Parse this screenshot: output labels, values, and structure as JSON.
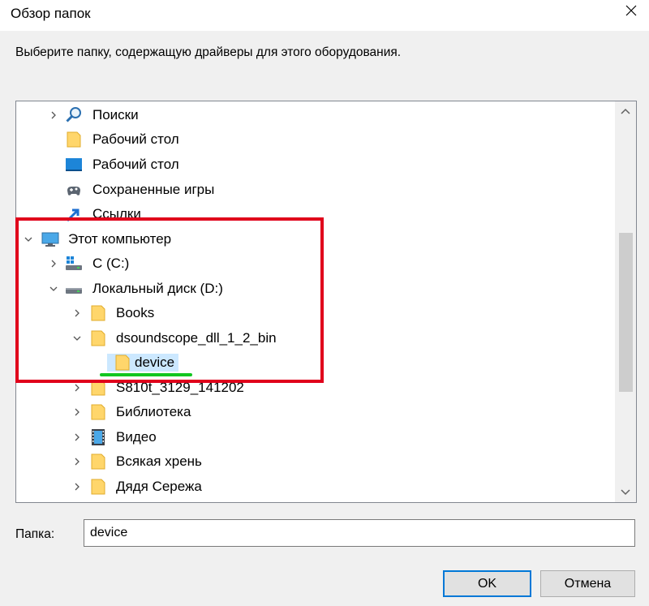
{
  "dialog": {
    "title": "Обзор папок",
    "instruction": "Выберите папку, содержащую драйверы для этого оборудования."
  },
  "tree": {
    "items": [
      {
        "label": "Поиски",
        "icon": "search-icon",
        "expander": "collapsed"
      },
      {
        "label": "Рабочий стол",
        "icon": "folder-icon",
        "expander": "none"
      },
      {
        "label": "Рабочий стол",
        "icon": "desktop-icon",
        "expander": "none"
      },
      {
        "label": "Сохраненные игры",
        "icon": "saved-games-icon",
        "expander": "none"
      },
      {
        "label": "Ссылки",
        "icon": "links-icon",
        "expander": "none"
      },
      {
        "label": "Этот компьютер",
        "icon": "computer-icon",
        "expander": "expanded"
      },
      {
        "label": "C (C:)",
        "icon": "system-drive-icon",
        "expander": "collapsed"
      },
      {
        "label": "Локальный диск (D:)",
        "icon": "drive-icon",
        "expander": "expanded"
      },
      {
        "label": "Books",
        "icon": "folder-icon",
        "expander": "collapsed"
      },
      {
        "label": "dsoundscope_dll_1_2_bin",
        "icon": "folder-icon",
        "expander": "expanded"
      },
      {
        "label": "device",
        "icon": "folder-icon",
        "expander": "none",
        "selected": true
      },
      {
        "label": "S810t_3129_141202",
        "icon": "folder-icon",
        "expander": "collapsed"
      },
      {
        "label": "Библиотека",
        "icon": "folder-icon",
        "expander": "collapsed"
      },
      {
        "label": "Видео",
        "icon": "video-icon",
        "expander": "collapsed"
      },
      {
        "label": "Всякая хрень",
        "icon": "folder-icon",
        "expander": "collapsed"
      },
      {
        "label": "Дядя Сережа",
        "icon": "folder-icon",
        "expander": "collapsed"
      }
    ]
  },
  "folder": {
    "label": "Папка:",
    "value": "device"
  },
  "buttons": {
    "ok": "OK",
    "cancel": "Отмена"
  },
  "colors": {
    "annotation_box": "#e0001b",
    "annotation_underline": "#12c620",
    "selection": "#cce8ff",
    "accent": "#0078d7"
  }
}
